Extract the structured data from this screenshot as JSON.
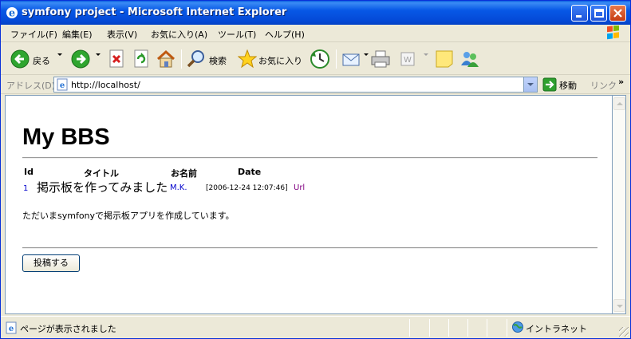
{
  "window": {
    "title": "symfony project - Microsoft Internet Explorer",
    "icon": "ie-icon"
  },
  "menu": [
    "ファイル(F)",
    "編集(E)",
    "表示(V)",
    "お気に入り(A)",
    "ツール(T)",
    "ヘルプ(H)"
  ],
  "toolbar": {
    "back_label": "戻る",
    "search_label": "検索",
    "favorites_label": "お気に入り"
  },
  "address": {
    "label": "アドレス(D)",
    "url": "http://localhost/",
    "go_label": "移動",
    "links_label": "リンク",
    "links_chevron": "»"
  },
  "page": {
    "title": "My BBS",
    "columns": [
      "Id",
      "タイトル",
      "お名前",
      "Date"
    ],
    "post": {
      "id": "1",
      "title": "掲示板を作ってみました",
      "name": "M.K.",
      "date": "[2006-12-24 12:07:46]",
      "url": "Url"
    },
    "body": "ただいまsymfonyで掲示板アプリを作成しています。",
    "post_button": "投稿する"
  },
  "status": {
    "text": "ページが表示されました",
    "zone": "イントラネット"
  },
  "colors": {
    "titlebar": "#0758e6",
    "link": "#0000cc",
    "visited": "#800080"
  }
}
